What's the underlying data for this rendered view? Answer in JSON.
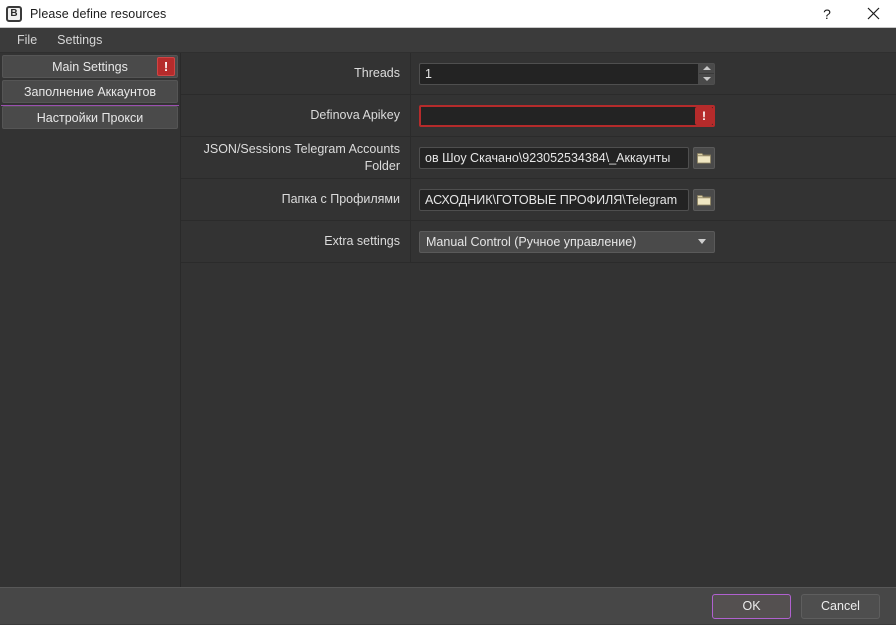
{
  "window": {
    "title": "Please define resources",
    "icon": "app-b-icon",
    "help_label": "?",
    "close_label": "✕"
  },
  "menubar": {
    "items": [
      {
        "label": "File",
        "name": "menu-file"
      },
      {
        "label": "Settings",
        "name": "menu-settings"
      }
    ]
  },
  "sidebar": {
    "items": [
      {
        "label": "Main Settings",
        "selected": true,
        "badge": "!"
      },
      {
        "label": "Заполнение Аккаунтов",
        "selected": false,
        "badge": ""
      },
      {
        "label": "Настройки Прокси",
        "selected": false,
        "badge": ""
      }
    ],
    "accent_color": "#9b4fb0"
  },
  "form": {
    "rows": [
      {
        "label": "Threads",
        "type": "spinbox",
        "value": "1",
        "placeholder": ""
      },
      {
        "label": "Definova Apikey",
        "type": "text-error",
        "value": "",
        "placeholder": "",
        "badge": "!"
      },
      {
        "label": "JSON/Sessions Telegram Accounts Folder",
        "type": "text-browse",
        "value": "ов Шоу Скачано\\923052534384\\_Аккаунты",
        "placeholder": "",
        "browse_icon": "folder-icon"
      },
      {
        "label": "Папка с Профилями",
        "type": "text-browse",
        "value": "АСХОДНИК\\ГОТОВЫЕ ПРОФИЛЯ\\Telegram",
        "placeholder": "",
        "browse_icon": "folder-icon"
      },
      {
        "label": "Extra settings",
        "type": "combo",
        "value": "Manual Control (Ручное управление)",
        "options": [
          "Manual Control (Ручное управление)"
        ]
      }
    ]
  },
  "footer": {
    "ok_label": "OK",
    "cancel_label": "Cancel",
    "default_button_color": "#b061cf"
  }
}
